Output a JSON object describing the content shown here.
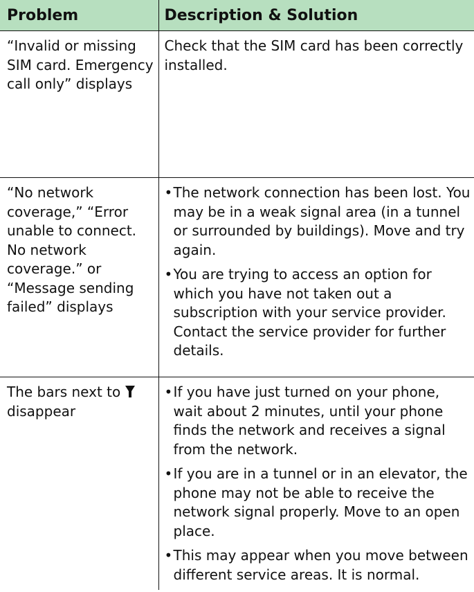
{
  "table": {
    "headers": {
      "problem": "Problem",
      "description": "Description & Solution"
    },
    "rows": [
      {
        "problem": "“Invalid or missing SIM card. Emergency call only” displays",
        "description": "Check that the SIM card has been correctly installed."
      },
      {
        "problem": "“No network coverage,” “Error unable to connect. No network coverage.” or “Message sending failed” displays",
        "bullets": [
          "The network connection has been lost. You may be in a weak signal area (in a tunnel or surrounded by buildings). Move and try again.",
          "You are trying to access an option for which you have not taken out a subscription with your service provider. Contact the service provider for further details."
        ]
      },
      {
        "problem_prefix": "The bars next to",
        "problem_icon": "signal-strength-icon",
        "problem_suffix": "disappear",
        "bullets": [
          "If you have just turned on your phone, wait about 2 minutes, until your phone finds the network and receives a signal from the network.",
          "If you are in a tunnel or in an elevator, the phone may not be able to receive the network signal properly. Move to an open place.",
          "This may appear when you move between different service areas. It is normal."
        ]
      }
    ]
  },
  "colors": {
    "header_background": "#b7dfbf",
    "border": "#111111",
    "text": "#111111"
  }
}
